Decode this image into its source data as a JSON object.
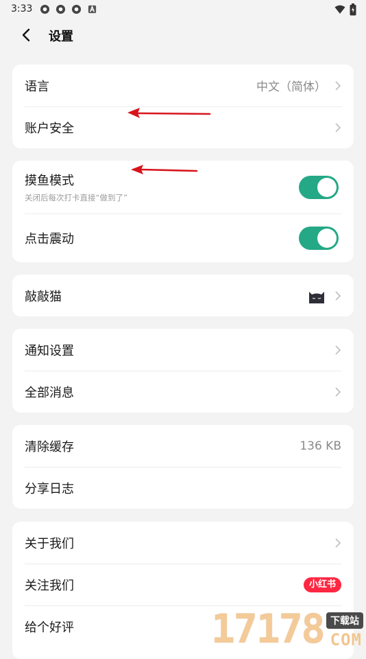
{
  "status_bar": {
    "time": "3:33"
  },
  "header": {
    "title": "设置"
  },
  "cards": {
    "general": {
      "language": {
        "label": "语言",
        "value": "中文（简体）"
      },
      "account": {
        "label": "账户安全"
      }
    },
    "modes": {
      "slack": {
        "label": "摸鱼模式",
        "subtitle": "关闭后每次打卡直接“做到了”",
        "enabled": true
      },
      "vibrate": {
        "label": "点击震动",
        "enabled": true
      }
    },
    "cat": {
      "label": "敲敲猫"
    },
    "notify": {
      "settings": {
        "label": "通知设置"
      },
      "all": {
        "label": "全部消息"
      }
    },
    "storage": {
      "cache": {
        "label": "清除缓存",
        "value": "136 KB"
      },
      "log": {
        "label": "分享日志"
      }
    },
    "about": {
      "about_us": {
        "label": "关于我们"
      },
      "follow": {
        "label": "关注我们",
        "badge": "小红书"
      },
      "review": {
        "label": "给个好评"
      }
    }
  },
  "watermark": {
    "digits": "17178",
    "tag": "下载站",
    "domain": "COM"
  },
  "colors": {
    "toggle_on": "#25a886",
    "badge_red": "#ff2741",
    "annotation_arrow": "#d8141c"
  }
}
